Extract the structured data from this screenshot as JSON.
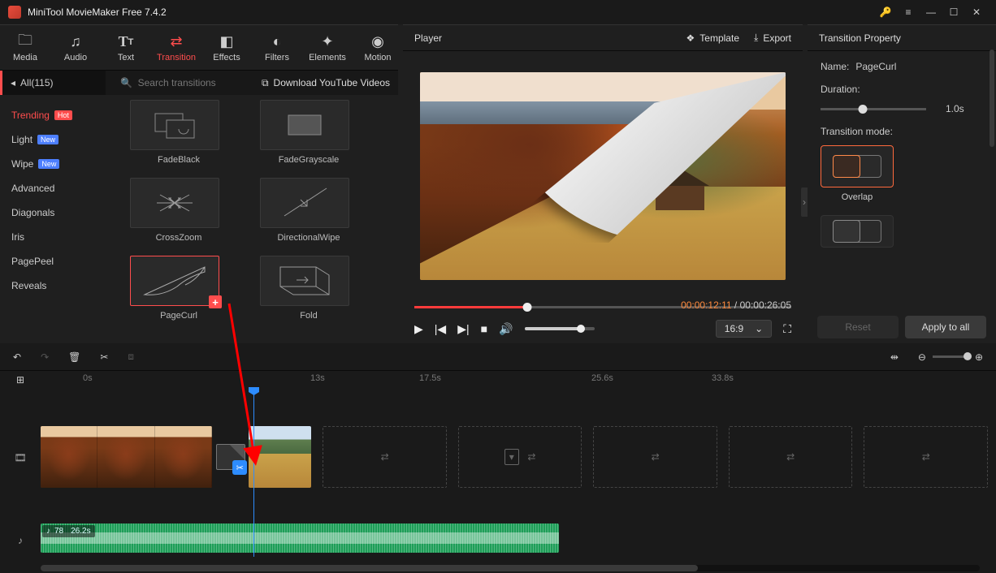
{
  "titlebar": {
    "title": "MiniTool MovieMaker Free 7.4.2"
  },
  "tabs": {
    "media": "Media",
    "audio": "Audio",
    "text": "Text",
    "transition": "Transition",
    "effects": "Effects",
    "filters": "Filters",
    "elements": "Elements",
    "motion": "Motion"
  },
  "browser": {
    "all_label": "All(115)",
    "search_placeholder": "Search transitions",
    "download_label": "Download YouTube Videos",
    "categories": [
      "Trending",
      "Light",
      "Wipe",
      "Advanced",
      "Diagonals",
      "Iris",
      "PagePeel",
      "Reveals"
    ],
    "badges": {
      "Trending": "Hot",
      "Light": "New",
      "Wipe": "New"
    },
    "thumbs": [
      "FadeBlack",
      "FadeGrayscale",
      "CrossZoom",
      "DirectionalWipe",
      "PageCurl",
      "Fold"
    ],
    "selected": "PageCurl"
  },
  "player": {
    "title": "Player",
    "template_btn": "Template",
    "export_btn": "Export",
    "time_current": "00:00:12:11",
    "time_total": "00:00:26:05",
    "ratio": "16:9"
  },
  "props": {
    "title": "Transition Property",
    "name_label": "Name:",
    "name_value": "PageCurl",
    "duration_label": "Duration:",
    "duration_value": "1.0s",
    "mode_label": "Transition mode:",
    "mode_overlap": "Overlap",
    "reset": "Reset",
    "apply": "Apply to all"
  },
  "timeline": {
    "marks": {
      "m0": "0s",
      "m1": "13s",
      "m2": "17.5s",
      "m3": "25.6s",
      "m4": "33.8s"
    },
    "audio_vol": "78",
    "audio_dur": "26.2s"
  }
}
